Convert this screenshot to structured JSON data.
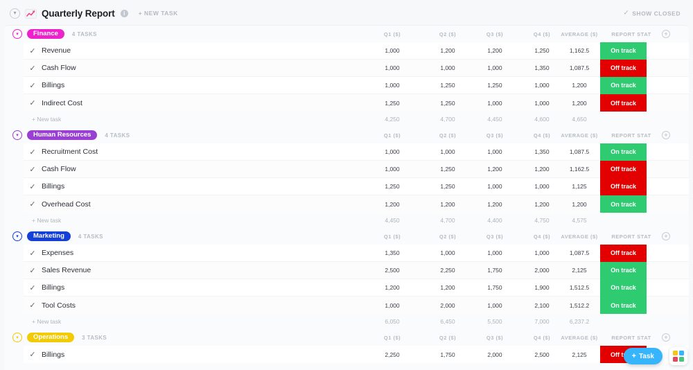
{
  "header": {
    "title": "Quarterly Report",
    "chart_icon": "line-chart-icon",
    "info_icon": "info-icon",
    "collapse_icon": "chevron-down-circle-icon",
    "new_task_label": "+ NEW TASK",
    "show_closed_label": "SHOW CLOSED",
    "show_closed_check": "✓"
  },
  "columns": [
    "Q1 ($)",
    "Q2 ($)",
    "Q3 ($)",
    "Q4 ($)",
    "AVERAGE ($)",
    "REPORT STAT"
  ],
  "add_column_icon": "plus-circle-icon",
  "colors": {
    "finance": "#ee22cc",
    "human_resources": "#9a3fd4",
    "marketing": "#1440d8",
    "operations": "#f2cb05",
    "on_track": "#2ecb71",
    "off_track": "#e30000",
    "fab": "#36b5fd"
  },
  "new_task_row_label": "+ New task",
  "fab": {
    "label": "Task",
    "plus": "+"
  },
  "apps_icon": "apps-grid-icon",
  "groups": [
    {
      "name": "Finance",
      "color_key": "finance",
      "task_count": "4 TASKS",
      "tasks": [
        {
          "name": "Revenue",
          "values": [
            "1,000",
            "1,200",
            "1,200",
            "1,250",
            "1,162.5"
          ],
          "status": "On track",
          "status_key": "on_track"
        },
        {
          "name": "Cash Flow",
          "values": [
            "1,000",
            "1,000",
            "1,000",
            "1,350",
            "1,087.5"
          ],
          "status": "Off track",
          "status_key": "off_track"
        },
        {
          "name": "Billings",
          "values": [
            "1,000",
            "1,250",
            "1,250",
            "1,000",
            "1,200"
          ],
          "status": "On track",
          "status_key": "on_track"
        },
        {
          "name": "Indirect Cost",
          "values": [
            "1,250",
            "1,250",
            "1,000",
            "1,000",
            "1,200"
          ],
          "status": "Off track",
          "status_key": "off_track"
        }
      ],
      "totals": [
        "4,250",
        "4,700",
        "4,450",
        "4,600",
        "4,650"
      ]
    },
    {
      "name": "Human Resources",
      "color_key": "human_resources",
      "task_count": "4 TASKS",
      "tasks": [
        {
          "name": "Recruitment Cost",
          "values": [
            "1,000",
            "1,000",
            "1,000",
            "1,350",
            "1,087.5"
          ],
          "status": "On track",
          "status_key": "on_track"
        },
        {
          "name": "Cash Flow",
          "values": [
            "1,000",
            "1,250",
            "1,200",
            "1,200",
            "1,162.5"
          ],
          "status": "Off track",
          "status_key": "off_track"
        },
        {
          "name": "Billings",
          "values": [
            "1,250",
            "1,250",
            "1,000",
            "1,000",
            "1,125"
          ],
          "status": "Off track",
          "status_key": "off_track"
        },
        {
          "name": "Overhead Cost",
          "values": [
            "1,200",
            "1,200",
            "1,200",
            "1,200",
            "1,200"
          ],
          "status": "On track",
          "status_key": "on_track"
        }
      ],
      "totals": [
        "4,450",
        "4,700",
        "4,400",
        "4,750",
        "4,575"
      ]
    },
    {
      "name": "Marketing",
      "color_key": "marketing",
      "task_count": "4 TASKS",
      "tasks": [
        {
          "name": "Expenses",
          "values": [
            "1,350",
            "1,000",
            "1,000",
            "1,000",
            "1,087.5"
          ],
          "status": "Off track",
          "status_key": "off_track"
        },
        {
          "name": "Sales Revenue",
          "values": [
            "2,500",
            "2,250",
            "1,750",
            "2,000",
            "2,125"
          ],
          "status": "On track",
          "status_key": "on_track"
        },
        {
          "name": "Billings",
          "values": [
            "1,200",
            "1,200",
            "1,750",
            "1,900",
            "1,512.5"
          ],
          "status": "On track",
          "status_key": "on_track"
        },
        {
          "name": "Tool Costs",
          "values": [
            "1,000",
            "2,000",
            "1,000",
            "2,100",
            "1,512.2"
          ],
          "status": "On track",
          "status_key": "on_track"
        }
      ],
      "totals": [
        "6,050",
        "6,450",
        "5,500",
        "7,000",
        "6,237.2"
      ]
    },
    {
      "name": "Operations",
      "color_key": "operations",
      "task_count": "3 TASKS",
      "tasks": [
        {
          "name": "Billings",
          "values": [
            "2,250",
            "1,750",
            "2,000",
            "2,500",
            "2,125"
          ],
          "status": "Off track",
          "status_key": "off_track"
        }
      ],
      "totals": []
    }
  ]
}
